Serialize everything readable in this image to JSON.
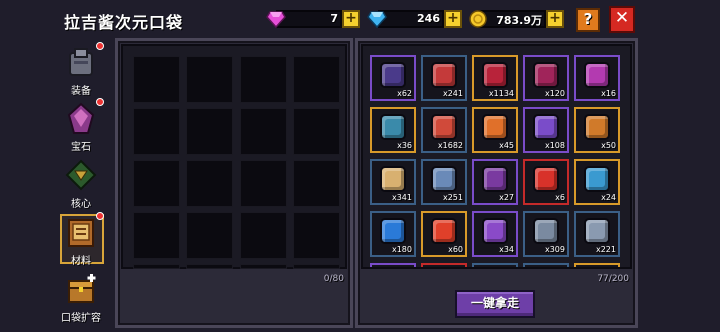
{
  "title": "拉吉酱次元口袋",
  "currencies": [
    {
      "name": "pink-gem",
      "value": "7",
      "color": "#e64fd8"
    },
    {
      "name": "blue-diamond",
      "value": "246",
      "color": "#3fb3f0"
    },
    {
      "name": "gold-coin",
      "value": "783.9万",
      "color": "#f5c82a"
    }
  ],
  "plus_label": "+",
  "help_label": "?",
  "close_label": "✕",
  "sidebar": [
    {
      "label": "装备",
      "icon": "armor-icon",
      "dot": true,
      "active": false
    },
    {
      "label": "宝石",
      "icon": "gem-icon",
      "dot": true,
      "active": false
    },
    {
      "label": "核心",
      "icon": "core-icon",
      "dot": false,
      "active": false
    },
    {
      "label": "材料",
      "icon": "material-book-icon",
      "dot": true,
      "active": true
    },
    {
      "label": "口袋扩容",
      "icon": "chest-expand-icon",
      "dot": false,
      "active": false
    }
  ],
  "left_panel": {
    "count": "0/80"
  },
  "right_panel": {
    "count": "77/200"
  },
  "items": [
    {
      "qty": "x62",
      "border": "#7a4cc9",
      "color": "#4a3a8a"
    },
    {
      "qty": "x241",
      "border": "#3b5f86",
      "color": "#c43a3a"
    },
    {
      "qty": "x1134",
      "border": "#d89a2a",
      "color": "#b8233a"
    },
    {
      "qty": "x120",
      "border": "#7a4cc9",
      "color": "#a0245a"
    },
    {
      "qty": "x16",
      "border": "#7a4cc9",
      "color": "#b33ab0"
    },
    {
      "qty": "x36",
      "border": "#d89a2a",
      "color": "#3a8aaa"
    },
    {
      "qty": "x1682",
      "border": "#3b5f86",
      "color": "#d04a3a"
    },
    {
      "qty": "x45",
      "border": "#d89a2a",
      "color": "#e0702a"
    },
    {
      "qty": "x108",
      "border": "#7a4cc9",
      "color": "#7a4cc9"
    },
    {
      "qty": "x50",
      "border": "#d89a2a",
      "color": "#d07a2a"
    },
    {
      "qty": "x341",
      "border": "#3b5f86",
      "color": "#d8b070"
    },
    {
      "qty": "x251",
      "border": "#3b5f86",
      "color": "#6a8ab8"
    },
    {
      "qty": "x27",
      "border": "#7a4cc9",
      "color": "#7a3aa0"
    },
    {
      "qty": "x6",
      "border": "#c42a2a",
      "color": "#d8322a"
    },
    {
      "qty": "x24",
      "border": "#d89a2a",
      "color": "#3a9ad0"
    },
    {
      "qty": "x180",
      "border": "#3b5f86",
      "color": "#2a7ad8"
    },
    {
      "qty": "x60",
      "border": "#d89a2a",
      "color": "#e0402a"
    },
    {
      "qty": "x34",
      "border": "#7a4cc9",
      "color": "#8a4ac8"
    },
    {
      "qty": "x309",
      "border": "#3b5f86",
      "color": "#7a8aa0"
    },
    {
      "qty": "x221",
      "border": "#3b5f86",
      "color": "#8a9ab0"
    }
  ],
  "take_all_label": "一键拿走"
}
